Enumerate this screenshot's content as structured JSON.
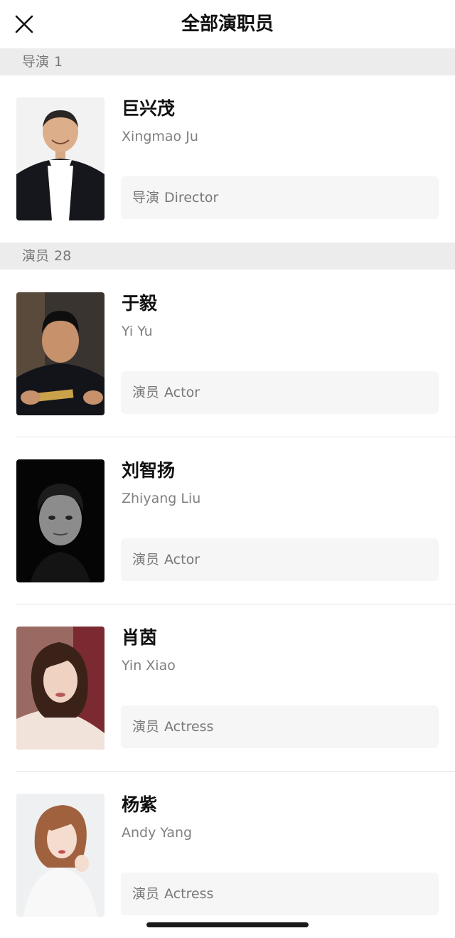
{
  "nav": {
    "title": "全部演职员",
    "close_icon": "close-icon"
  },
  "sections": {
    "directors": {
      "label": "导演",
      "count": "1"
    },
    "actors": {
      "label": "演员",
      "count": "28"
    }
  },
  "people": [
    {
      "name_cn": "巨兴茂",
      "name_en": "Xingmao Ju",
      "role_cn": "导演",
      "role_en": "Director"
    },
    {
      "name_cn": "于毅",
      "name_en": "Yi Yu",
      "role_cn": "演员",
      "role_en": "Actor"
    },
    {
      "name_cn": "刘智扬",
      "name_en": "Zhiyang Liu",
      "role_cn": "演员",
      "role_en": "Actor"
    },
    {
      "name_cn": "肖茵",
      "name_en": "Yin Xiao",
      "role_cn": "演员",
      "role_en": "Actress"
    },
    {
      "name_cn": "杨紫",
      "name_en": "Andy Yang",
      "role_cn": "演员",
      "role_en": "Actress"
    }
  ],
  "colors": {
    "section_bg": "#ececec",
    "role_bg": "#f6f6f6",
    "secondary_text": "#808080"
  }
}
